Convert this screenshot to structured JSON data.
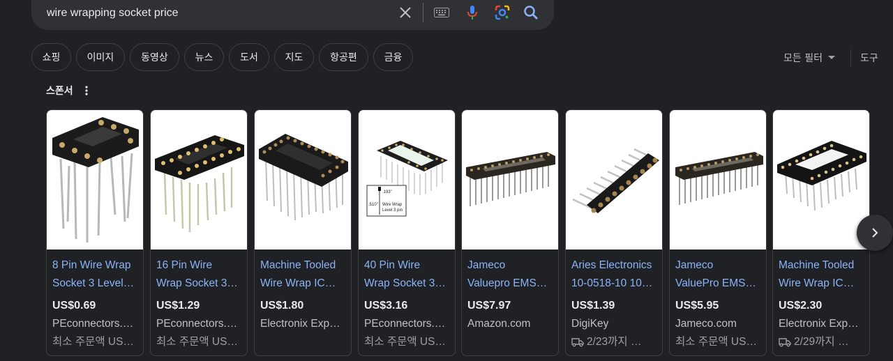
{
  "search": {
    "query": "wire wrapping socket price"
  },
  "filters": [
    "쇼핑",
    "이미지",
    "동영상",
    "뉴스",
    "도서",
    "지도",
    "항공편",
    "금융"
  ],
  "tools": {
    "all_filters": "모든 필터",
    "tools": "도구"
  },
  "sponsored_label": "스폰서",
  "products": [
    {
      "title_line1": "8 Pin Wire Wrap",
      "title_line2": "Socket 3 Level…",
      "price": "US$0.69",
      "store": "PEconnectors.…",
      "extra": "최소 주문액 US…",
      "extra_icon": "none"
    },
    {
      "title_line1": "16 Pin Wire",
      "title_line2": "Wrap Socket 3…",
      "price": "US$1.29",
      "store": "PEconnectors.…",
      "extra": "최소 주문액 US…",
      "extra_icon": "none"
    },
    {
      "title_line1": "Machine Tooled",
      "title_line2": "Wire Wrap IC…",
      "price": "US$1.80",
      "store": "Electronix Exp…",
      "extra": "",
      "extra_icon": "none"
    },
    {
      "title_line1": "40 Pin Wire",
      "title_line2": "Wrap Socket 3…",
      "price": "US$3.16",
      "store": "PEconnectors.…",
      "extra": "최소 주문액 US…",
      "extra_icon": "none"
    },
    {
      "title_line1": "Jameco",
      "title_line2": "Valuepro EMS…",
      "price": "US$7.97",
      "store": "Amazon.com",
      "extra": "",
      "extra_icon": "none"
    },
    {
      "title_line1": "Aries Electronics",
      "title_line2": "10-0518-10 10…",
      "price": "US$1.39",
      "store": "DigiKey",
      "extra": "2/23까지 …",
      "extra_icon": "truck-icon"
    },
    {
      "title_line1": "Jameco",
      "title_line2": "ValuePro EMS…",
      "price": "US$5.95",
      "store": "Jameco.com",
      "extra": "최소 주문액 US…",
      "extra_icon": "none"
    },
    {
      "title_line1": "Machine Tooled",
      "title_line2": "Wire Wrap IC…",
      "price": "US$2.30",
      "store": "Electronix Exp…",
      "extra": "2/29까지 …",
      "extra_icon": "truck-icon"
    }
  ],
  "diagram_text": {
    "dim1": ".193\"",
    "dim2": ".510\"",
    "line1": "Wire  Wrap",
    "line2": "Level 3 pin"
  },
  "colors": {
    "background": "#202124",
    "link": "#8ab4f8",
    "chip_border": "#3c4043"
  }
}
